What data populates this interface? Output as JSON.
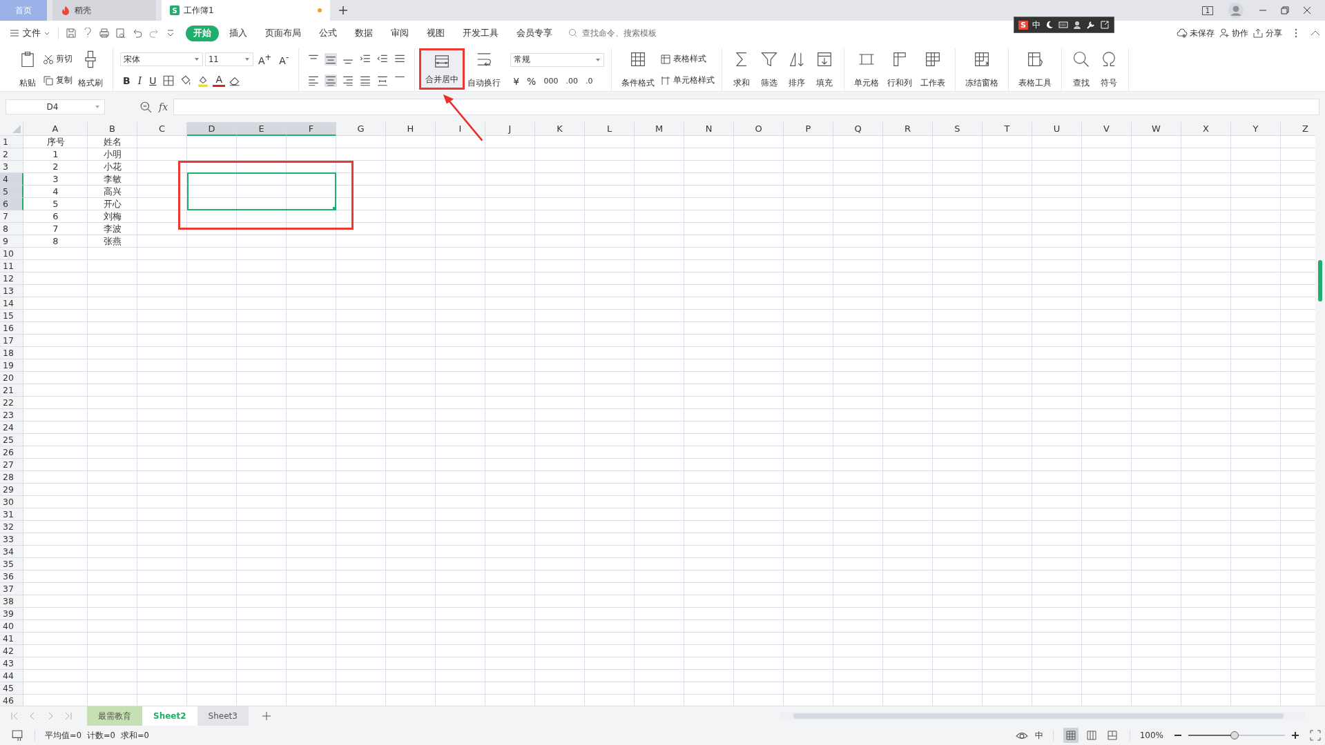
{
  "title_tabs": [
    {
      "label": "首页",
      "kind": "home",
      "selected": false
    },
    {
      "label": "稻壳",
      "kind": "docer",
      "selected": false
    },
    {
      "label": "工作簿1",
      "kind": "sheet",
      "logo": "S",
      "selected": true,
      "unsaved": true
    }
  ],
  "page_indicator": "1",
  "ime_bar": {
    "logo": "S",
    "mode": "中"
  },
  "menu": {
    "file": "文件",
    "tabs": [
      {
        "label": "开始",
        "selected": true
      },
      {
        "label": "插入",
        "selected": false
      },
      {
        "label": "页面布局",
        "selected": false
      },
      {
        "label": "公式",
        "selected": false
      },
      {
        "label": "数据",
        "selected": false
      },
      {
        "label": "审阅",
        "selected": false
      },
      {
        "label": "视图",
        "selected": false
      },
      {
        "label": "开发工具",
        "selected": false
      },
      {
        "label": "会员专享",
        "selected": false
      }
    ],
    "search": {
      "placeholder": "查找命令、搜索模板"
    },
    "actions": [
      "未保存",
      "协作",
      "分享"
    ]
  },
  "ribbon": {
    "paste": "粘贴",
    "cut": "剪切",
    "copy": "复制",
    "format_painter": "格式刷",
    "font_family": "宋体",
    "font_size": "11",
    "grow": "A$^{+}$",
    "shrink": "A$^{-}$",
    "bold": "B",
    "italic": "I",
    "underline": "U",
    "font_color": "A",
    "merge": {
      "label": "合并居中",
      "annotated": true
    },
    "wrap": "自动换行",
    "number_format": "常规",
    "currency": "¥",
    "percent": "%",
    "thousands": "000",
    "add_decimal": ".00",
    "remove_decimal": ".0",
    "conditional": "条件格式",
    "table_style": "表格样式",
    "cell_style": "单元格样式",
    "tools": [
      "求和",
      "筛选",
      "排序",
      "填充"
    ],
    "cells": [
      "单元格",
      "行和列",
      "工作表"
    ],
    "freeze": "冻结窗格",
    "table_tools": "表格工具",
    "find": [
      "查找",
      "符号"
    ]
  },
  "name_box": "D4",
  "formula_label": "fx",
  "grid": {
    "columns": [
      {
        "label": "A",
        "selected": false
      },
      {
        "label": "B",
        "selected": false
      },
      {
        "label": "C",
        "selected": false
      },
      {
        "label": "D",
        "selected": true
      },
      {
        "label": "E",
        "selected": true
      },
      {
        "label": "F",
        "selected": true
      },
      {
        "label": "G",
        "selected": false
      },
      {
        "label": "H",
        "selected": false
      },
      {
        "label": "I",
        "selected": false
      },
      {
        "label": "J",
        "selected": false
      },
      {
        "label": "K",
        "selected": false
      },
      {
        "label": "L",
        "selected": false
      },
      {
        "label": "M",
        "selected": false
      },
      {
        "label": "N",
        "selected": false
      },
      {
        "label": "O",
        "selected": false
      },
      {
        "label": "P",
        "selected": false
      },
      {
        "label": "Q",
        "selected": false
      },
      {
        "label": "R",
        "selected": false
      },
      {
        "label": "S",
        "selected": false
      },
      {
        "label": "T",
        "selected": false
      },
      {
        "label": "U",
        "selected": false
      },
      {
        "label": "V",
        "selected": false
      },
      {
        "label": "W",
        "selected": false
      },
      {
        "label": "X",
        "selected": false
      },
      {
        "label": "Y",
        "selected": false
      },
      {
        "label": "Z",
        "selected": false
      }
    ],
    "rows": [
      {
        "label": "1",
        "selected": false,
        "cells": [
          "序号",
          "姓名"
        ]
      },
      {
        "label": "2",
        "selected": false,
        "cells": [
          "1",
          "小明"
        ]
      },
      {
        "label": "3",
        "selected": false,
        "cells": [
          "2",
          "小花"
        ]
      },
      {
        "label": "4",
        "selected": true,
        "cells": [
          "3",
          "李敏"
        ]
      },
      {
        "label": "5",
        "selected": true,
        "cells": [
          "4",
          "高兴"
        ]
      },
      {
        "label": "6",
        "selected": true,
        "cells": [
          "5",
          "开心"
        ]
      },
      {
        "label": "7",
        "selected": false,
        "cells": [
          "6",
          "刘梅"
        ]
      },
      {
        "label": "8",
        "selected": false,
        "cells": [
          "7",
          "李波"
        ]
      },
      {
        "label": "9",
        "selected": false,
        "cells": [
          "8",
          "张燕"
        ]
      },
      {
        "label": "10",
        "selected": false,
        "cells": []
      },
      {
        "label": "11",
        "selected": false,
        "cells": []
      },
      {
        "label": "12",
        "selected": false,
        "cells": []
      },
      {
        "label": "13",
        "selected": false,
        "cells": []
      },
      {
        "label": "14",
        "selected": false,
        "cells": []
      },
      {
        "label": "15",
        "selected": false,
        "cells": []
      },
      {
        "label": "16",
        "selected": false,
        "cells": []
      },
      {
        "label": "17",
        "selected": false,
        "cells": []
      },
      {
        "label": "18",
        "selected": false,
        "cells": []
      },
      {
        "label": "19",
        "selected": false,
        "cells": []
      },
      {
        "label": "20",
        "selected": false,
        "cells": []
      },
      {
        "label": "21",
        "selected": false,
        "cells": []
      },
      {
        "label": "22",
        "selected": false,
        "cells": []
      },
      {
        "label": "23",
        "selected": false,
        "cells": []
      },
      {
        "label": "24",
        "selected": false,
        "cells": []
      },
      {
        "label": "25",
        "selected": false,
        "cells": []
      },
      {
        "label": "26",
        "selected": false,
        "cells": []
      },
      {
        "label": "27",
        "selected": false,
        "cells": []
      },
      {
        "label": "28",
        "selected": false,
        "cells": []
      },
      {
        "label": "29",
        "selected": false,
        "cells": []
      },
      {
        "label": "30",
        "selected": false,
        "cells": []
      },
      {
        "label": "31",
        "selected": false,
        "cells": []
      },
      {
        "label": "32",
        "selected": false,
        "cells": []
      },
      {
        "label": "33",
        "selected": false,
        "cells": []
      },
      {
        "label": "34",
        "selected": false,
        "cells": []
      },
      {
        "label": "35",
        "selected": false,
        "cells": []
      },
      {
        "label": "36",
        "selected": false,
        "cells": []
      },
      {
        "label": "37",
        "selected": false,
        "cells": []
      },
      {
        "label": "38",
        "selected": false,
        "cells": []
      },
      {
        "label": "39",
        "selected": false,
        "cells": []
      },
      {
        "label": "40",
        "selected": false,
        "cells": []
      },
      {
        "label": "41",
        "selected": false,
        "cells": []
      },
      {
        "label": "42",
        "selected": false,
        "cells": []
      },
      {
        "label": "43",
        "selected": false,
        "cells": []
      },
      {
        "label": "44",
        "selected": false,
        "cells": []
      },
      {
        "label": "45",
        "selected": false,
        "cells": []
      },
      {
        "label": "46",
        "selected": false,
        "cells": []
      }
    ]
  },
  "sheet_tabs": [
    {
      "label": "最需教育",
      "selected": false,
      "color": "#c6e0b4"
    },
    {
      "label": "Sheet2",
      "selected": true
    },
    {
      "label": "Sheet3",
      "selected": false
    }
  ],
  "status": {
    "stats": [
      "平均值=0",
      "计数=0",
      "求和=0"
    ],
    "ime": "中",
    "view_modes": [
      {
        "selected": true
      },
      {
        "selected": false
      },
      {
        "selected": false
      }
    ],
    "zoom": "100%",
    "zoom_slider": {
      "level": 0.48
    }
  }
}
